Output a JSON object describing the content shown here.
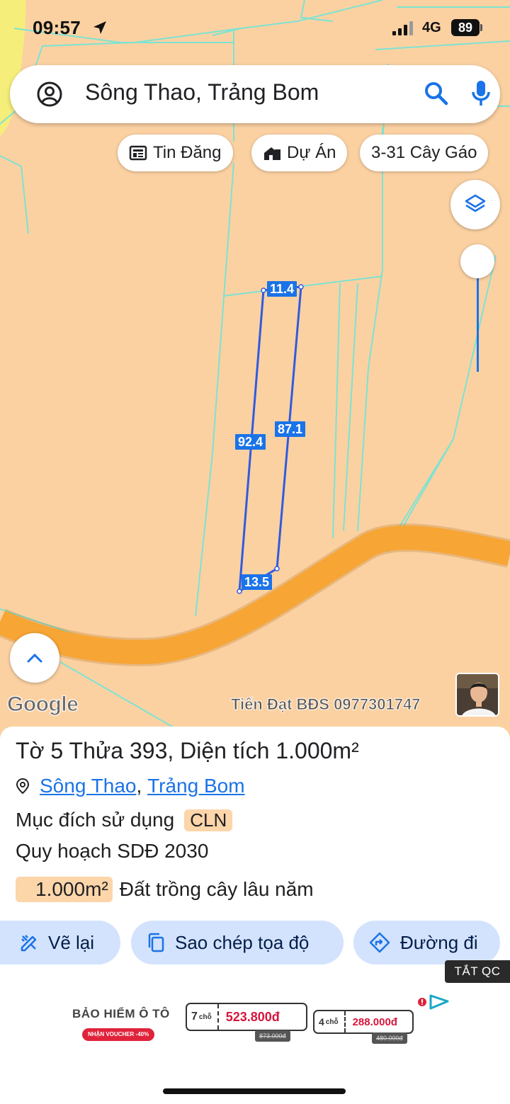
{
  "status_bar": {
    "time": "09:57",
    "network": "4G",
    "battery": "89"
  },
  "search": {
    "query": "Sông Thao, Trảng Bom"
  },
  "chips": [
    {
      "label": "Tin Đăng",
      "icon": "newspaper-icon"
    },
    {
      "label": "Dự Án",
      "icon": "building-icon"
    },
    {
      "label": "3-31 Cây Gáo",
      "icon": ""
    }
  ],
  "map": {
    "measurements": {
      "top": "11.4",
      "left": "92.4",
      "right": "87.1",
      "bottom": "13.5"
    },
    "brand": "Google",
    "watermark": "Tiến Đạt BĐS 0977301747",
    "colors": {
      "land": "#fbd1a2",
      "road": "#f7a534",
      "parcel_lines": "#7de3d2",
      "measure": "#1a73e8"
    }
  },
  "parcel": {
    "title": "Tờ 5 Thửa 393, Diện tích 1.000m²",
    "address_ward": "Sông Thao",
    "address_sep": ",",
    "address_district": "Trảng Bom",
    "purpose_label": "Mục đích sử dụng",
    "purpose_code": "CLN",
    "plan": "Quy hoạch SDĐ 2030",
    "area_value": "1.000m²",
    "area_type": "Đất trồng cây lâu năm"
  },
  "actions": {
    "redraw": "Vẽ lại",
    "copy_coords": "Sao chép tọa độ",
    "directions": "Đường đi"
  },
  "ad": {
    "close_label": "TẮT QC",
    "brand": "BẢO HIỂM Ô TÔ",
    "voucher": "NHẬN VOUCHER -40%",
    "offers": [
      {
        "seats": "7",
        "unit": "chỗ",
        "price": "523.800đ",
        "old_price": "873.000đ"
      },
      {
        "seats": "4",
        "unit": "chỗ",
        "price": "288.000đ",
        "old_price": "480.000đ"
      }
    ]
  }
}
